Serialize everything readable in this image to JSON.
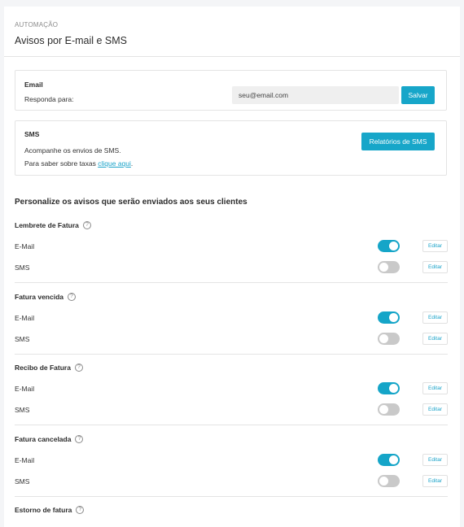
{
  "header": {
    "eyebrow": "AUTOMAÇÃO",
    "title": "Avisos por E-mail e SMS"
  },
  "email_card": {
    "label": "Email",
    "reply_to_label": "Responda para:",
    "reply_to_value": "seu@email.com",
    "save_label": "Salvar"
  },
  "sms_card": {
    "label": "SMS",
    "description": "Acompanhe os envios de SMS.",
    "fees_prefix": "Para saber sobre taxas ",
    "fees_link": "clique aqui",
    "fees_suffix": ".",
    "reports_label": "Relatórios de SMS"
  },
  "section": {
    "title": "Personalize os avisos que serão enviados aos seus clientes"
  },
  "colors": {
    "accent": "#17a6c9",
    "toggle_off": "#c9c9c9"
  },
  "notifications": [
    {
      "label": "Lembrete de Fatura",
      "rows": [
        {
          "channel": "E-Mail",
          "enabled": true,
          "edit_label": "Editar"
        },
        {
          "channel": "SMS",
          "enabled": false,
          "edit_label": "Editar"
        }
      ]
    },
    {
      "label": "Fatura vencida",
      "rows": [
        {
          "channel": "E-Mail",
          "enabled": true,
          "edit_label": "Editar"
        },
        {
          "channel": "SMS",
          "enabled": false,
          "edit_label": "Editar"
        }
      ]
    },
    {
      "label": "Recibo de Fatura",
      "rows": [
        {
          "channel": "E-Mail",
          "enabled": true,
          "edit_label": "Editar"
        },
        {
          "channel": "SMS",
          "enabled": false,
          "edit_label": "Editar"
        }
      ]
    },
    {
      "label": "Fatura cancelada",
      "rows": [
        {
          "channel": "E-Mail",
          "enabled": true,
          "edit_label": "Editar"
        },
        {
          "channel": "SMS",
          "enabled": false,
          "edit_label": "Editar"
        }
      ]
    },
    {
      "label": "Estorno de fatura",
      "rows": []
    }
  ]
}
